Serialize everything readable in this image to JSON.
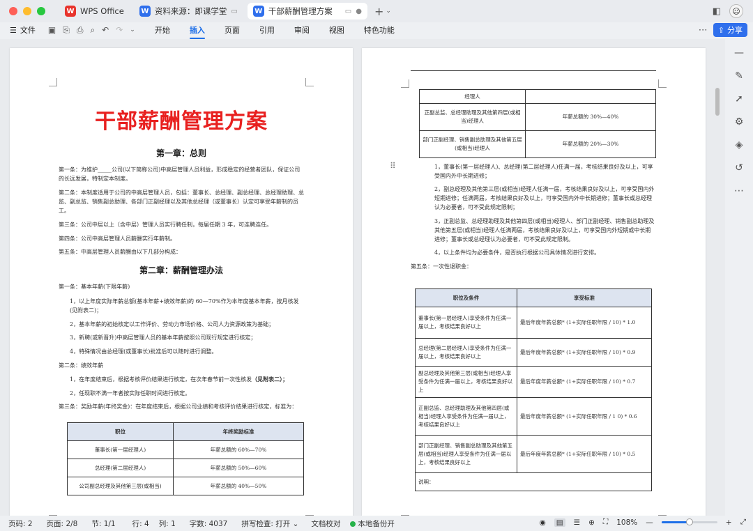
{
  "titlebar": {
    "tabs": [
      {
        "label": "WPS Office"
      },
      {
        "label": "资料来源：即课学堂"
      },
      {
        "label": "干部薪酬管理方案"
      }
    ]
  },
  "ribbon": {
    "file_label": "文件",
    "menu": [
      "开始",
      "插入",
      "页面",
      "引用",
      "审阅",
      "视图",
      "特色功能"
    ],
    "active_menu": "插入",
    "share_label": "分享"
  },
  "page1": {
    "title": "干部薪酬管理方案",
    "chapter1": "第一章：总则",
    "ch1_paras": [
      "第一条：为维护_____公司(以下简称公司)中高层管理人员利益，形成稳定的经营者团队，保证公司的长远发展，特制定本制度。",
      "第二条：本制度适用于公司的中高层管理人员，包括：董事长、总经理、副总经理、总经理助理、总监、副总监、销售副总助理、各部门正副经理以及其他总经理（或董事长）认定可享受年薪制的员工。",
      "第三条：公司中层以上（含中层）管理人员实行聘任制，每届任期 3 年，可连聘连任。",
      "第四条：公司中高层管理人员薪酬实行年薪制。",
      "第五条：中高层管理人员薪酬由以下几部分构成："
    ],
    "chapter2": "第二章：薪酬管理办法",
    "ch2_paras": [
      "第一条：基本年薪(下限年薪)",
      "1，以上年度实际年薪总额(基本年薪+绩效年薪)的 60—70%作为本年度基本年薪，按月核发(见附表二)；",
      "2，基本年薪的初始核定以工作评价、劳动力市场价格、公司人力资源政策为基础；",
      "3，新聘(或新晋升)中高层管理人员的基本年薪按照公司现行规定进行核定；",
      "4，特殊情况由总经理(或董事长)批准后可以随时进行调整。",
      "第二条：绩效年薪",
      "1，在年度结束后，根据考核评价结果进行核定，在次年春节前一次性核发",
      "2，任现职不满一年者按实际任职时间进行核定。",
      "第三条：奖励年薪(年终奖金)：在年度结束后，根据公司业绩和考核评价结果进行核定，标准为："
    ],
    "bold_note": "（见附表二）；",
    "table": {
      "headers": [
        "职位",
        "年终奖励标准"
      ],
      "rows": [
        [
          "董事长(第一层经理人)",
          "年薪总额的 60%—70%"
        ],
        [
          "总经理(第二层经理人)",
          "年薪总额的 50%—60%"
        ],
        [
          "公司副总经理及其他第三层(或相当)",
          "年薪总额的 40%—50%"
        ]
      ]
    }
  },
  "page2": {
    "top_table": {
      "rows": [
        [
          "经理人",
          ""
        ],
        [
          "正副总监、总经理助理及其他第四层(或相当)经理人",
          "年薪总额的 30%—40%"
        ],
        [
          "部门正副经理、销售副总助理及其他第五层(或相当)经理人",
          "年薪总额的 20%—30%"
        ]
      ]
    },
    "paras": [
      "1，董事长(第一层经理人)、总经理(第二层经理人)任满一届，考核结果良好及以上，可享受国内外中长期进修；",
      "2，副总经理及其他第三层(或相当)经理人任满一届，考核结果良好及以上，可享受国内外短期进修；任满两届，考核结果良好及以上，可享受国内外中长期进修；董事长或总经理认为必要者，可不受此规定限制；",
      "3，正副总监、总经理助理及其他第四层(或相当)经理人、部门正副经理、销售副总助理及其他第五层(或相当)经理人任满两届，考核结果良好及以上，可享受国内外短期或中长期进修；董事长或总经理认为必要者，可不受此规定限制。",
      "4，以上条件均为必要条件，是否执行根据公司具体情况进行安排。",
      "第五条：一次性退职金："
    ],
    "table": {
      "headers": [
        "职位及条件",
        "享受标准"
      ],
      "rows": [
        [
          "董事长(第一层经理人)享受条件为任满一届以上，考核结果良好以上",
          "最后年度年薪总额* (1+实际任职年限 / 10) * 1.0"
        ],
        [
          "总经理(第二层经理人)享受条件为任满一届以上，考核结果良好以上",
          "最后年度年薪总额* (1+实际任职年限 / 10) * 0.9"
        ],
        [
          "副总经理及其他第三层(或相当)经理人享受条件为任满一届以上，考核结果良好以上",
          "最后年度年薪总额* (1+实际任职年限 / 10) * 0.7"
        ],
        [
          "正副总监、总经理助理及其他第四层(或相当)经理人享受条件为任满一届以上，考核结果良好以上",
          "最后年度年薪总额* (1+实际任职年限 / 1 0) * 0.6"
        ],
        [
          "部门正副经理、销售副总助理及其他第五层(或相当)经理人享受条件为任满一届以上，考核结果良好以上",
          "最后年度年薪总额* (1+实际任职年限 / 10) * 0.5"
        ]
      ],
      "note": "说明："
    }
  },
  "status": {
    "page_code": "页码: 2",
    "page": "页面: 2/8",
    "section": "节: 1/1",
    "row": "行: 4",
    "col": "列: 1",
    "words": "字数: 4037",
    "spell": "拼写检查: 打开",
    "proof": "文档校对",
    "backup": "本地备份开",
    "zoom": "108%",
    "zoom_level": 0.5
  }
}
